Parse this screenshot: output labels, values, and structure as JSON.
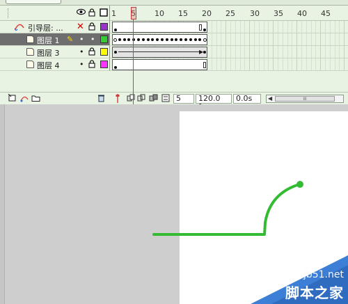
{
  "timeline": {
    "ruler_labels": [
      "1",
      "5",
      "10",
      "15",
      "20",
      "25",
      "30",
      "35",
      "40",
      "45"
    ],
    "header_icons": {
      "eye": "eye-icon",
      "lock": "lock-icon",
      "outline": "outline-square-icon"
    },
    "layers": [
      {
        "name": "引导层: ...",
        "type": "guide",
        "visible_glyph": "✕",
        "lock_glyph": "🔒",
        "color": "#9933cc",
        "selected": false
      },
      {
        "name": "图层 1",
        "type": "normal",
        "visible_glyph": "•",
        "lock_glyph": "•",
        "color": "#33cc33",
        "selected": true,
        "pencil": "✎"
      },
      {
        "name": "图层 3",
        "type": "normal",
        "visible_glyph": "•",
        "lock_glyph": "🔒",
        "color": "#ffff00",
        "selected": false
      },
      {
        "name": "图层 4",
        "type": "normal",
        "visible_glyph": "•",
        "lock_glyph": "🔒",
        "color": "#ff33ff",
        "selected": false
      }
    ],
    "footer": {
      "current_frame": "5",
      "fps": "120.0 fps",
      "elapsed": "0.0s",
      "scroll_mark": "III"
    }
  },
  "stage": {
    "line_color": "#33bb33",
    "path_shape": "horizontal line with upward curve",
    "watermark": {
      "url": "jb51.net",
      "text": "脚本之家"
    }
  },
  "colors": {
    "timeline_bg": "#e8f3e3",
    "selected_row": "#6e6e6e",
    "playhead": "#d23c3c",
    "stage_bg": "#cecece",
    "canvas_bg": "#ffffff",
    "watermark_blue": "#3d7fd6"
  }
}
